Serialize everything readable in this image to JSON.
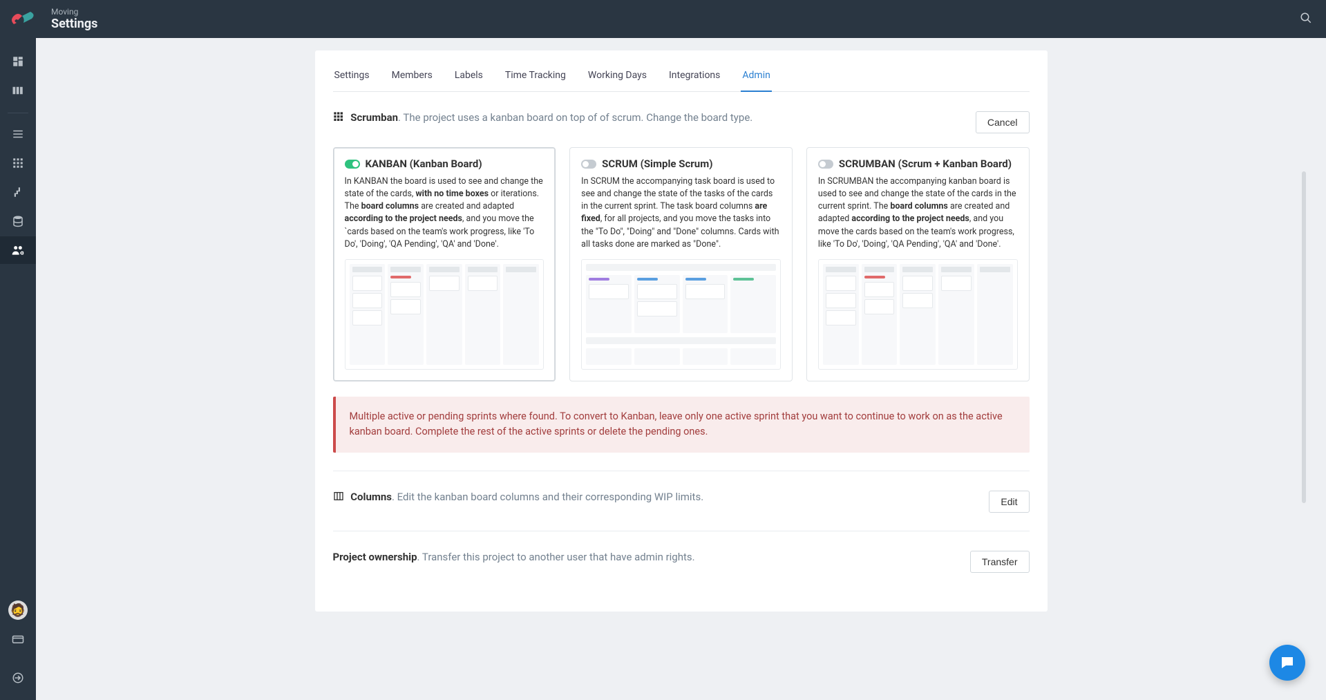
{
  "header": {
    "breadcrumb": "Moving",
    "title": "Settings"
  },
  "tabs": {
    "settings": "Settings",
    "members": "Members",
    "labels": "Labels",
    "time": "Time Tracking",
    "days": "Working Days",
    "integrations": "Integrations",
    "admin": "Admin",
    "active": "admin"
  },
  "board_type": {
    "title": "Scrumban",
    "desc": ". The project uses a kanban board on top of of scrum. Change the board type.",
    "cancel": "Cancel",
    "options": {
      "kanban": {
        "title": "KANBAN (Kanban Board)",
        "p1": "In KANBAN the board is used to see and change the state of the cards, ",
        "b1": "with no time boxes",
        "p2": " or iterations. The ",
        "b2": "board columns",
        "p3": " are created and adapted ",
        "b3": "according to the project needs",
        "p4": ", and you move the `cards based on the team's work progress, like 'To Do', 'Doing', 'QA Pending', 'QA' and 'Done'."
      },
      "scrum": {
        "title": "SCRUM (Simple Scrum)",
        "p1": "In SCRUM the accompanying task board is used to see and change the state of the tasks of the cards in the current sprint. The task board columns ",
        "b1": "are fixed",
        "p2": ", for all projects, and you move the tasks into the \"To Do\", \"Doing\" and \"Done\" columns. Cards with all tasks done are marked as \"Done\"."
      },
      "scrumban": {
        "title": "SCRUMBAN (Scrum + Kanban Board)",
        "p1": "In SCRUMBAN the accompanying kanban board is used to see and change the state of the cards in the current sprint. The ",
        "b1": "board columns",
        "p2": " are created and adapted ",
        "b2": "according to the project needs",
        "p3": ", and you move the cards based on the team's work progress, like 'To Do', 'Doing', 'QA Pending', 'QA' and 'Done'."
      }
    },
    "warning": "Multiple active or pending sprints where found. To convert to Kanban, leave only one active sprint that you want to continue to work on as the active kanban board. Complete the rest of the active sprints or delete the pending ones."
  },
  "columns": {
    "title": "Columns",
    "desc": ". Edit the kanban board columns and their corresponding WIP limits.",
    "action": "Edit"
  },
  "ownership": {
    "title": "Project ownership",
    "desc": ". Transfer this project to another user that have admin rights.",
    "action": "Transfer"
  },
  "colors": {
    "accent": "#2a7fd1",
    "danger": "#cc4b4b",
    "fab": "#1d88e5"
  }
}
